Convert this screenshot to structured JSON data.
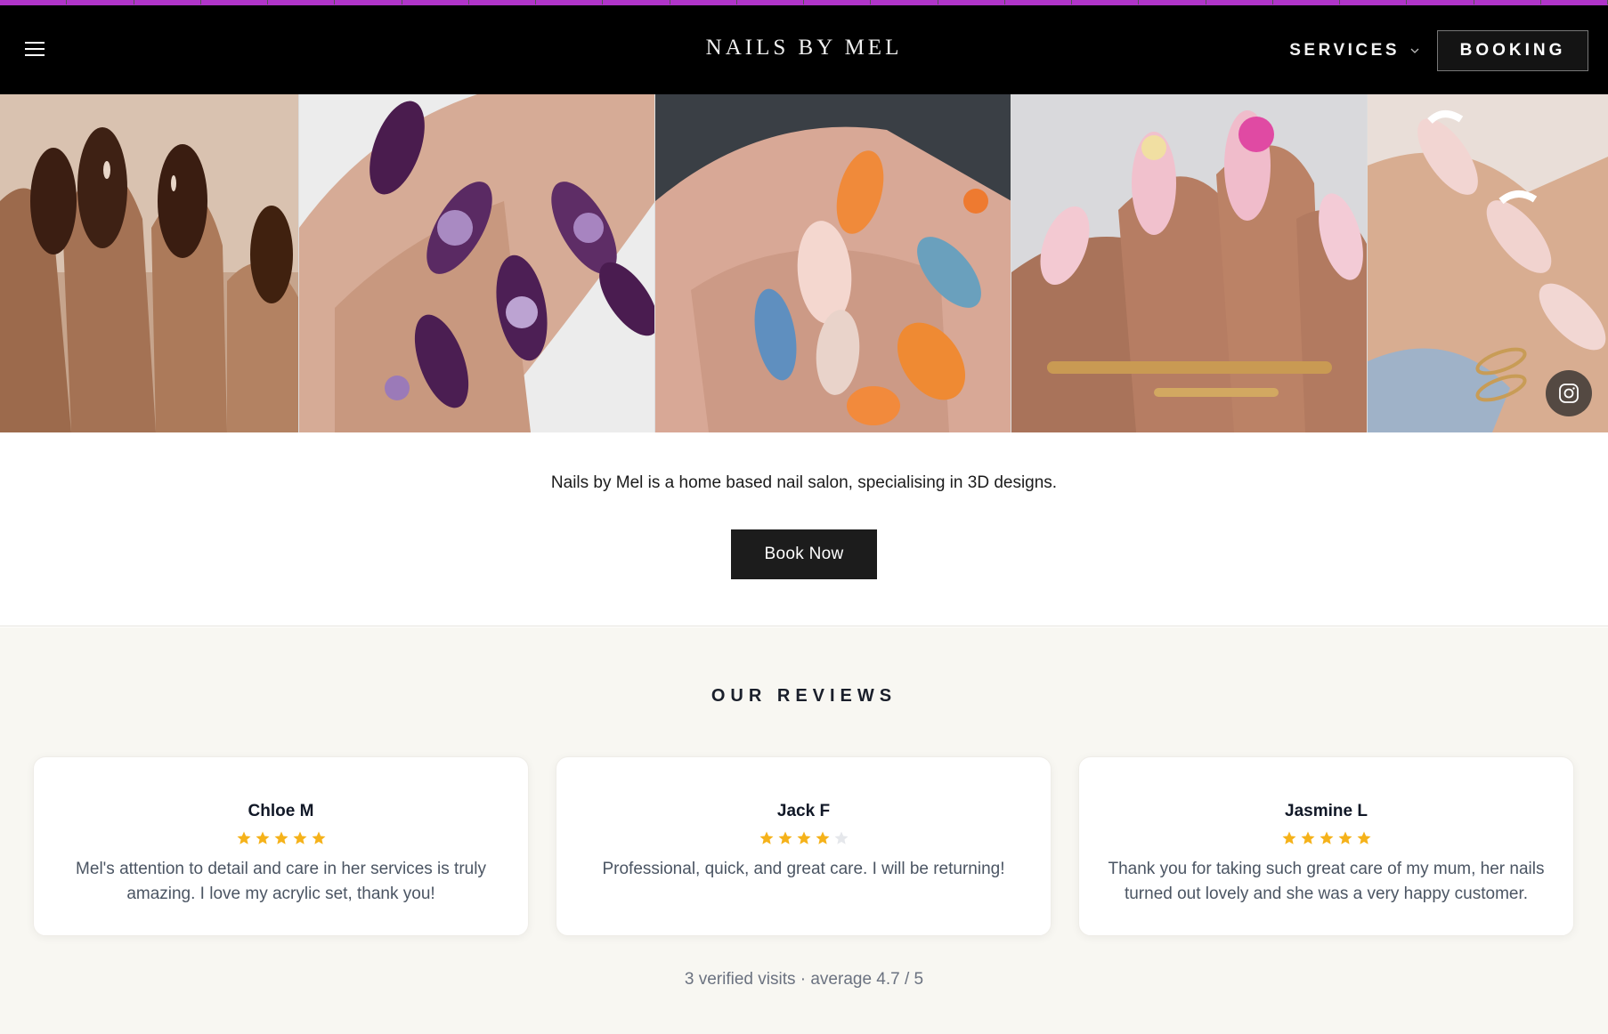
{
  "header": {
    "brand": "NAILS BY MEL",
    "menu_icon": "hamburger-menu-icon",
    "services_label": "SERVICES",
    "services_icon": "chevron-down-icon",
    "booking_label": "BOOKING"
  },
  "gallery": {
    "photos": [
      {
        "description_icon": "nail-photo",
        "palette": "dark-brown"
      },
      {
        "description_icon": "nail-photo",
        "palette": "purple-3d"
      },
      {
        "description_icon": "nail-photo",
        "palette": "orange-blue-art"
      },
      {
        "description_icon": "nail-photo",
        "palette": "pink-floral"
      },
      {
        "description_icon": "nail-photo",
        "palette": "french-nude"
      }
    ],
    "social_icon": "instagram-icon"
  },
  "intro": {
    "tagline": "Nails by Mel is a home based nail salon, specialising in 3D designs.",
    "cta_label": "Book Now"
  },
  "reviews": {
    "title": "OUR REVIEWS",
    "items": [
      {
        "name": "Chloe M",
        "rating": 5,
        "text": "Mel's attention to detail and care in her services is truly amazing. I love my acrylic set, thank you!"
      },
      {
        "name": "Jack F",
        "rating": 4,
        "text": "Professional, quick, and great care. I will be returning!"
      },
      {
        "name": "Jasmine L",
        "rating": 5,
        "text": "Thank you for taking such great care of my mum, her nails turned out lovely and she was a very happy customer."
      }
    ],
    "summary": "3 verified visits · average 4.7 / 5"
  },
  "colors": {
    "accent": "#b035c9",
    "header_bg": "#000000",
    "star_filled": "#f5b21a",
    "star_empty": "#e5e7eb",
    "reviews_bg": "#f8f7f2",
    "button_bg": "#1c1c1c"
  }
}
